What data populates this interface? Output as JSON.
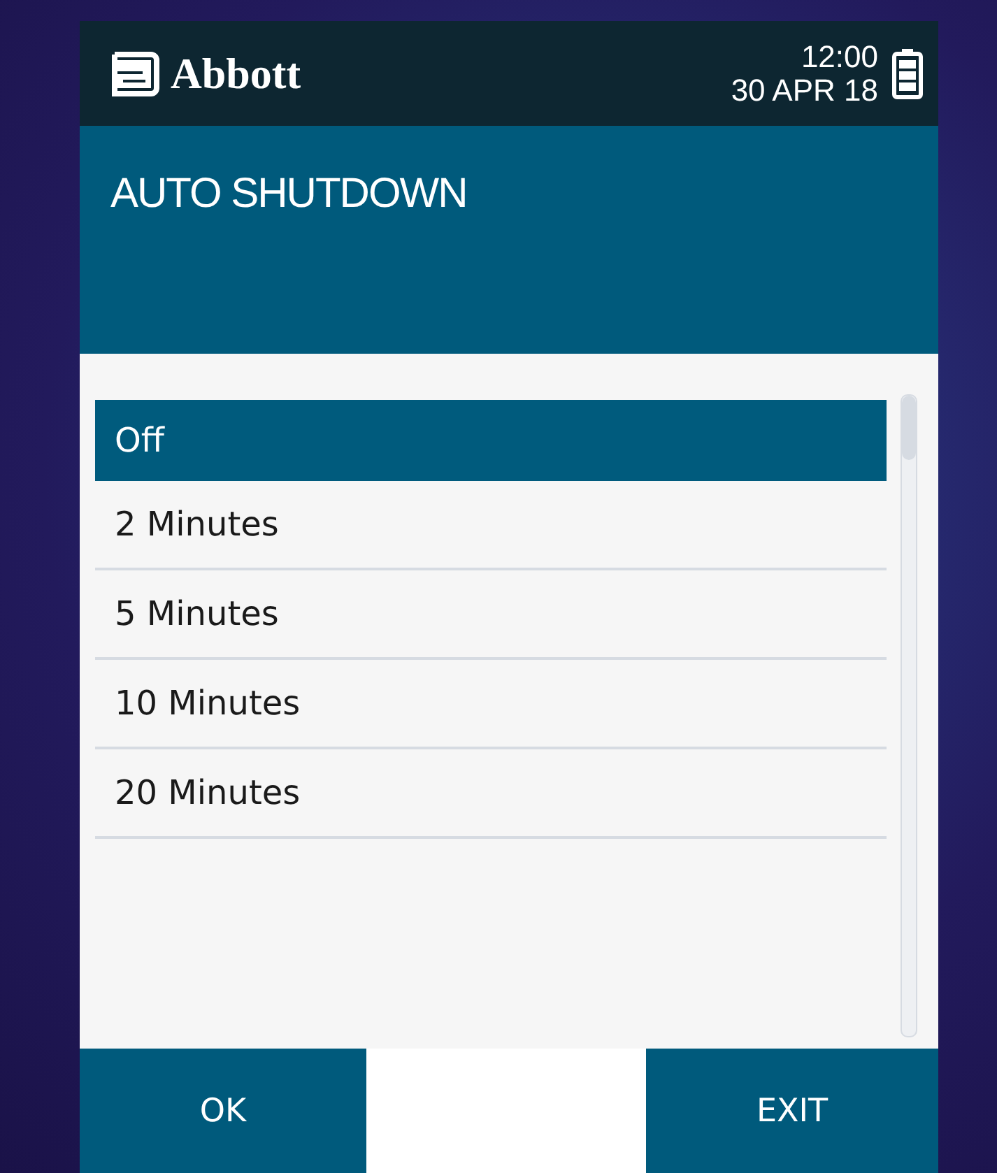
{
  "header": {
    "brand": "Abbott",
    "time": "12:00",
    "date": "30 APR 18"
  },
  "title": "AUTO SHUTDOWN",
  "options": [
    {
      "label": "Off",
      "selected": true
    },
    {
      "label": "2 Minutes",
      "selected": false
    },
    {
      "label": "5 Minutes",
      "selected": false
    },
    {
      "label": "10 Minutes",
      "selected": false
    },
    {
      "label": "20 Minutes",
      "selected": false
    }
  ],
  "buttons": [
    {
      "label": "OK"
    },
    {
      "label": "EXIT"
    }
  ]
}
